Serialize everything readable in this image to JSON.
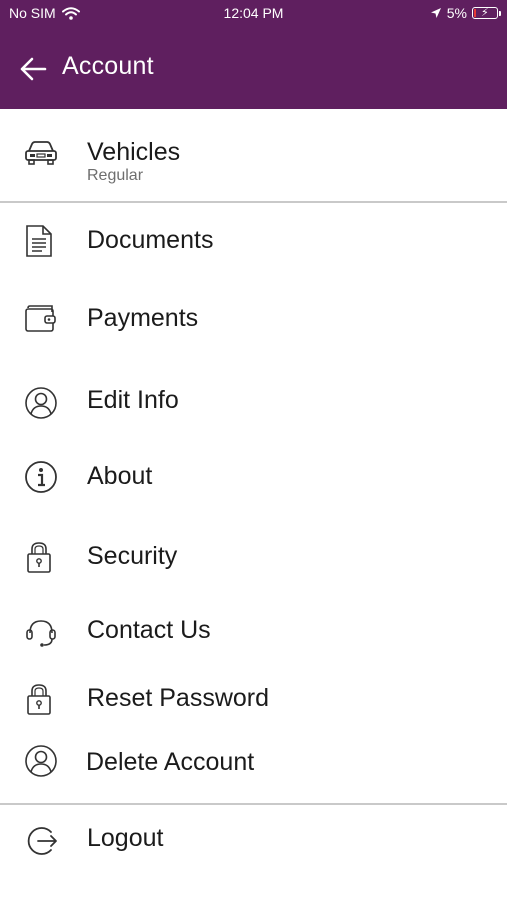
{
  "status_bar": {
    "carrier": "No SIM",
    "time": "12:04 PM",
    "battery": "5%"
  },
  "header": {
    "title": "Account",
    "color": "#5f1f5f"
  },
  "vehicles": {
    "label": "Vehicles",
    "subtitle": "Regular"
  },
  "menu": [
    {
      "label": "Documents",
      "icon": "document-icon"
    },
    {
      "label": "Payments",
      "icon": "wallet-icon"
    },
    {
      "label": "Edit Info",
      "icon": "user-circle-icon"
    },
    {
      "label": "About",
      "icon": "info-icon"
    },
    {
      "label": "Security",
      "icon": "lock-icon"
    },
    {
      "label": "Contact Us",
      "icon": "headset-icon"
    },
    {
      "label": "Reset Password",
      "icon": "lock-icon"
    },
    {
      "label": "Delete Account",
      "icon": "user-circle-icon"
    }
  ],
  "logout": {
    "label": "Logout",
    "icon": "logout-icon"
  }
}
